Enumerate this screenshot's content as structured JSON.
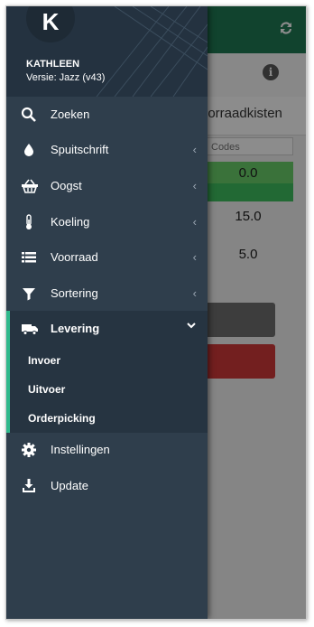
{
  "app": {
    "refresh_icon": "refresh-icon",
    "info_icon": "info-icon",
    "info_glyph": "i",
    "section_title": "oorraadkisten",
    "codes_placeholder": "Codes",
    "values": [
      "0.0",
      "15.0",
      "5.0"
    ]
  },
  "user": {
    "avatar_initial": "K",
    "name": "KATHLEEN",
    "version": "Versie: Jazz (v43)"
  },
  "menu": [
    {
      "label": "Zoeken",
      "icon": "search-icon"
    },
    {
      "label": "Spuitschrift",
      "icon": "drop-icon",
      "chevron": "chevron-left-icon"
    },
    {
      "label": "Oogst",
      "icon": "basket-icon",
      "chevron": "chevron-left-icon"
    },
    {
      "label": "Koeling",
      "icon": "thermometer-icon",
      "chevron": "chevron-left-icon"
    },
    {
      "label": "Voorraad",
      "icon": "list-icon",
      "chevron": "chevron-left-icon"
    },
    {
      "label": "Sortering",
      "icon": "filter-icon",
      "chevron": "chevron-left-icon"
    },
    {
      "label": "Levering",
      "icon": "truck-icon",
      "chevron": "chevron-down-icon",
      "expanded": true
    },
    {
      "label": "Instellingen",
      "icon": "gear-icon"
    },
    {
      "label": "Update",
      "icon": "download-icon"
    }
  ],
  "submenu": [
    {
      "label": "Invoer"
    },
    {
      "label": "Uitvoer"
    },
    {
      "label": "Orderpicking"
    }
  ],
  "colors": {
    "drawer_bg": "#2f3e4c",
    "accent": "#2fb98c",
    "app_header": "#1f7a55"
  }
}
